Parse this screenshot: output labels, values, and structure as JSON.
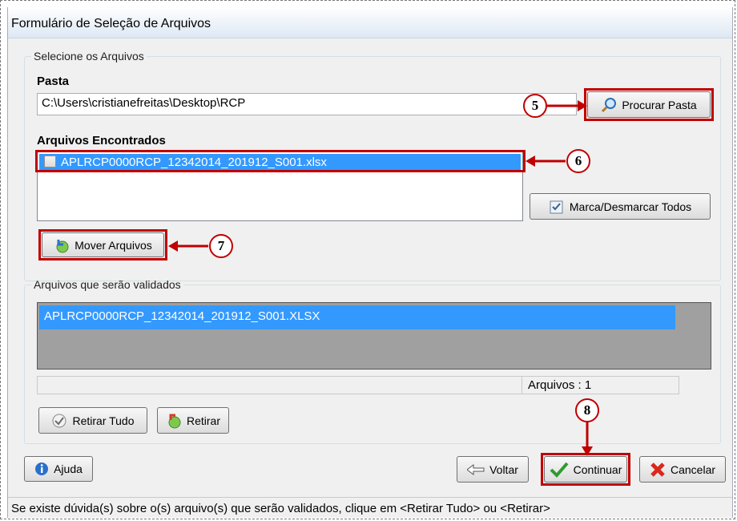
{
  "window": {
    "title": "Formulário de Seleção de Arquivos"
  },
  "select_group": {
    "legend": "Selecione os Arquivos",
    "folder_label": "Pasta",
    "folder_value": "C:\\Users\\cristianefreitas\\Desktop\\RCP",
    "browse_button": "Procurar Pasta",
    "found_label": "Arquivos Encontrados",
    "found_files": [
      "APLRCP0000RCP_12342014_201912_S001.xlsx"
    ],
    "toggle_all_button": "Marca/Desmarcar Todos",
    "move_button": "Mover Arquivos"
  },
  "validate_group": {
    "legend": "Arquivos que serão validados",
    "files": [
      "APLRCP0000RCP_12342014_201912_S001.XLSX"
    ],
    "count_label": "Arquivos : 1",
    "remove_all_button": "Retirar Tudo",
    "remove_button": "Retirar"
  },
  "footer": {
    "help_button": "Ajuda",
    "back_button": "Voltar",
    "continue_button": "Continuar",
    "cancel_button": "Cancelar"
  },
  "status": {
    "text": "Se existe dúvida(s) sobre o(s) arquivo(s) que serão validados, clique em <Retirar Tudo> ou <Retirar>"
  },
  "callouts": {
    "c5": "5",
    "c6": "6",
    "c7": "7",
    "c8": "8"
  },
  "colors": {
    "highlight": "#c00000",
    "selection": "#3399ff",
    "list_gray": "#a0a0a0"
  }
}
